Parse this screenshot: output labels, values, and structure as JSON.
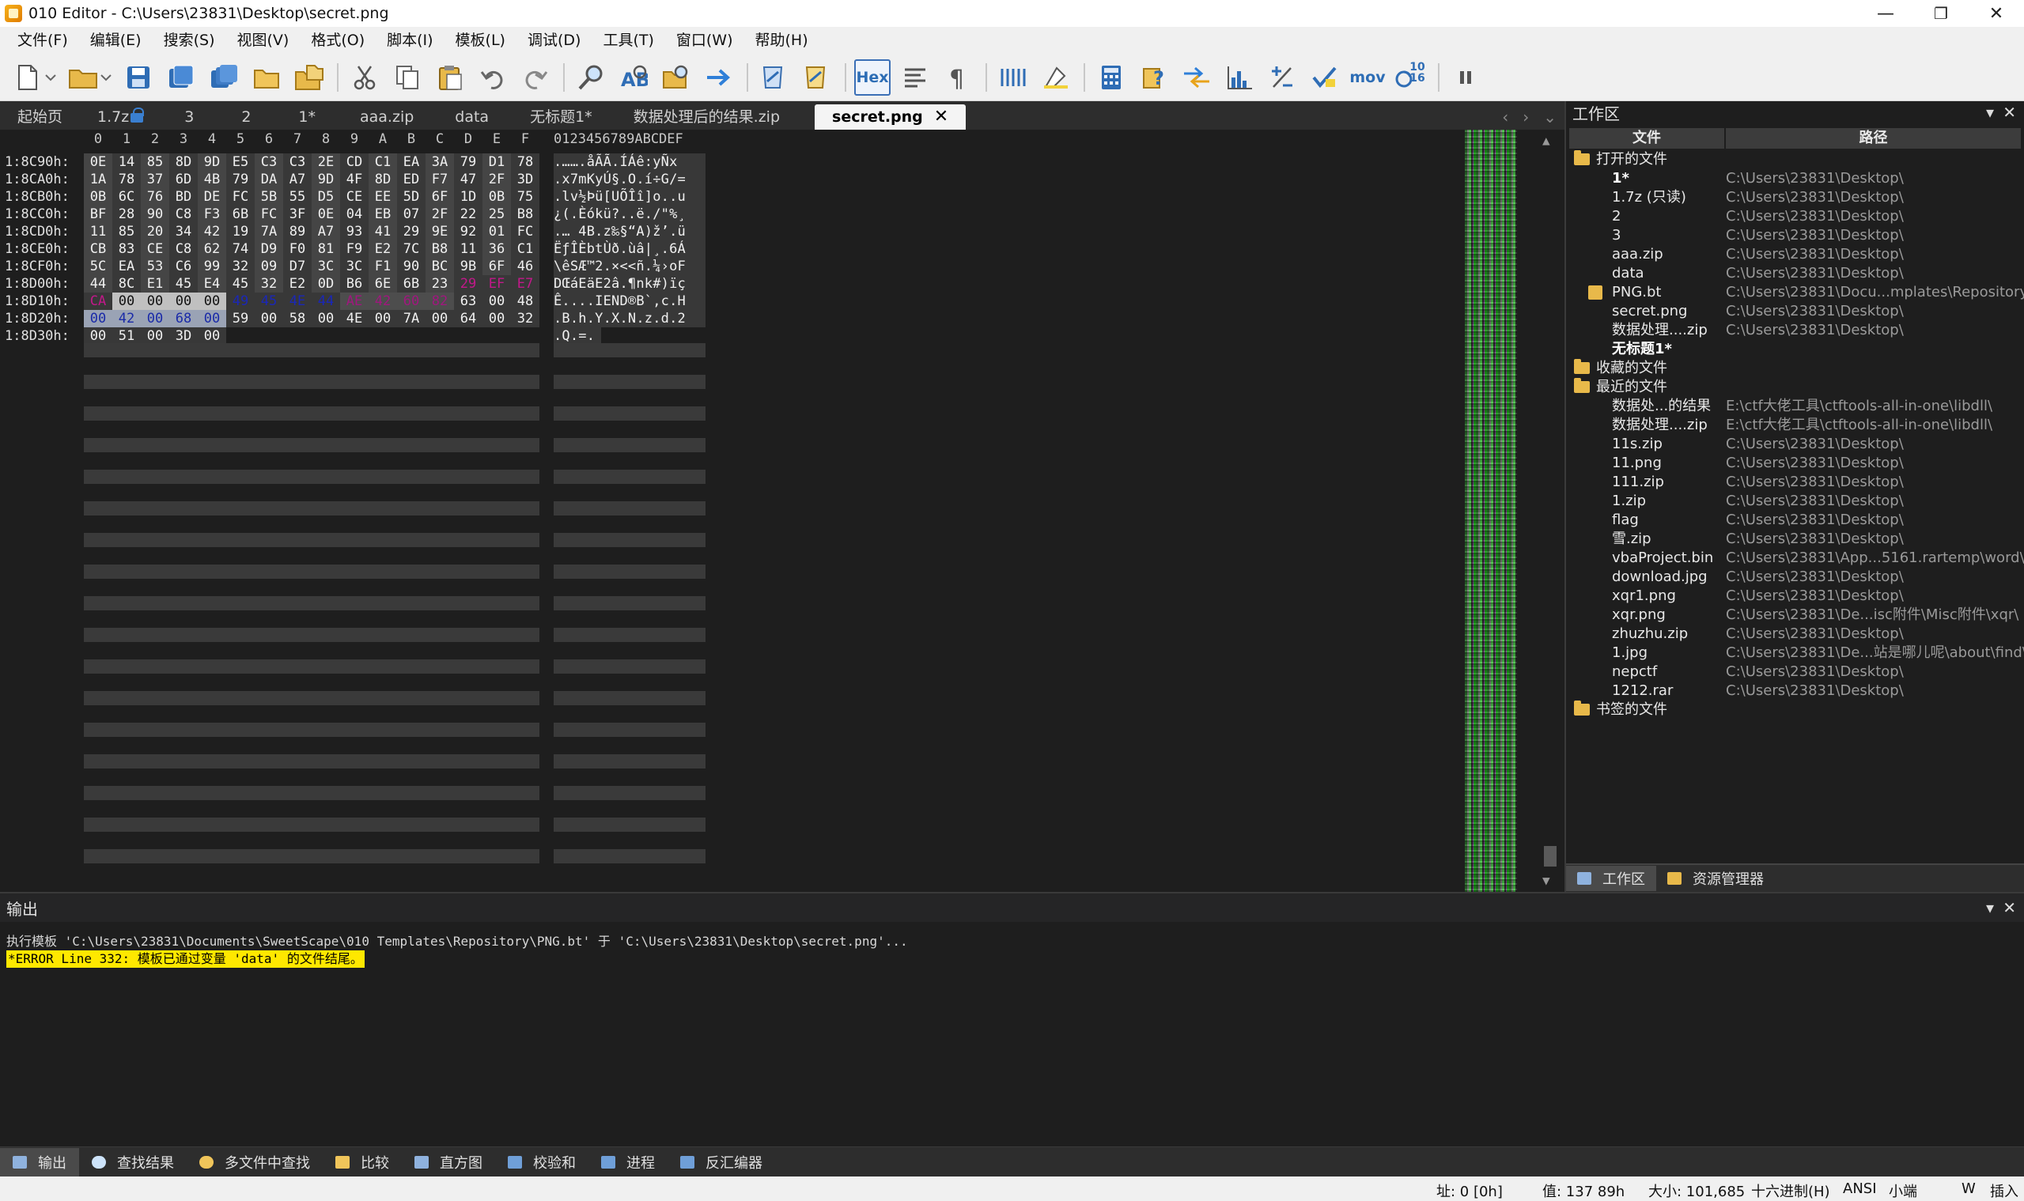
{
  "window": {
    "title": "010 Editor - C:\\Users\\23831\\Desktop\\secret.png",
    "minimize": "—",
    "restore": "❐",
    "close": "✕"
  },
  "menu": [
    "文件(F)",
    "编辑(E)",
    "搜索(S)",
    "视图(V)",
    "格式(O)",
    "脚本(I)",
    "模板(L)",
    "调试(D)",
    "工具(T)",
    "窗口(W)",
    "帮助(H)"
  ],
  "toolbar": {
    "hex_label": "Hex",
    "mov_label": "mov",
    "base_label_top": "10",
    "base_label_bottom": "16"
  },
  "tabs": [
    {
      "label": "起始页"
    },
    {
      "label": "1.7z",
      "locked": true
    },
    {
      "label": "3"
    },
    {
      "label": "2"
    },
    {
      "label": "1*"
    },
    {
      "label": "aaa.zip"
    },
    {
      "label": "data"
    },
    {
      "label": "无标题1*"
    },
    {
      "label": "数据处理后的结果.zip"
    },
    {
      "label": "secret.png",
      "active": true
    }
  ],
  "hex": {
    "header_cols": [
      "0",
      "1",
      "2",
      "3",
      "4",
      "5",
      "6",
      "7",
      "8",
      "9",
      "A",
      "B",
      "C",
      "D",
      "E",
      "F"
    ],
    "ascii_header": "0123456789ABCDEF",
    "rows": [
      {
        "addr": "1:8C90h:",
        "bytes": [
          "0E",
          "14",
          "85",
          "8D",
          "9D",
          "E5",
          "C3",
          "C3",
          "2E",
          "CD",
          "C1",
          "EA",
          "3A",
          "79",
          "D1",
          "78"
        ],
        "ascii": ".…….åÃÃ.ÍÁê:yÑx"
      },
      {
        "addr": "1:8CA0h:",
        "bytes": [
          "1A",
          "78",
          "37",
          "6D",
          "4B",
          "79",
          "DA",
          "A7",
          "9D",
          "4F",
          "8D",
          "ED",
          "F7",
          "47",
          "2F",
          "3D"
        ],
        "ascii": ".x7mKyÚ§.O.í÷G/="
      },
      {
        "addr": "1:8CB0h:",
        "bytes": [
          "0B",
          "6C",
          "76",
          "BD",
          "DE",
          "FC",
          "5B",
          "55",
          "D5",
          "CE",
          "EE",
          "5D",
          "6F",
          "1D",
          "0B",
          "75"
        ],
        "ascii": ".lv½Þü[UÕÎî]o..u"
      },
      {
        "addr": "1:8CC0h:",
        "bytes": [
          "BF",
          "28",
          "90",
          "C8",
          "F3",
          "6B",
          "FC",
          "3F",
          "0E",
          "04",
          "EB",
          "07",
          "2F",
          "22",
          "25",
          "B8"
        ],
        "ascii": "¿(.Èókü?..ë./\"%¸"
      },
      {
        "addr": "1:8CD0h:",
        "bytes": [
          "11",
          "85",
          "20",
          "34",
          "42",
          "19",
          "7A",
          "89",
          "A7",
          "93",
          "41",
          "29",
          "9E",
          "92",
          "01",
          "FC"
        ],
        "ascii": ".… 4B.z‰§“A)ž’.ü"
      },
      {
        "addr": "1:8CE0h:",
        "bytes": [
          "CB",
          "83",
          "CE",
          "C8",
          "62",
          "74",
          "D9",
          "F0",
          "81",
          "F9",
          "E2",
          "7C",
          "B8",
          "11",
          "36",
          "C1"
        ],
        "ascii": "ËƒÎÈbtÙð.ùâ|¸.6Á"
      },
      {
        "addr": "1:8CF0h:",
        "bytes": [
          "5C",
          "EA",
          "53",
          "C6",
          "99",
          "32",
          "09",
          "D7",
          "3C",
          "3C",
          "F1",
          "90",
          "BC",
          "9B",
          "6F",
          "46"
        ],
        "ascii": "\\êSÆ™2.×<<ñ.¼›oF"
      },
      {
        "addr": "1:8D00h:",
        "bytes": [
          "44",
          "8C",
          "E1",
          "45",
          "E4",
          "45",
          "32",
          "E2",
          "0D",
          "B6",
          "6E",
          "6B",
          "23",
          "29",
          "EF",
          "E7"
        ],
        "ascii": "DŒáEäE2â.¶nk#)ïç"
      },
      {
        "addr": "1:8D10h:",
        "bytes": [
          "CA",
          "00",
          "00",
          "00",
          "00",
          "49",
          "45",
          "4E",
          "44",
          "AE",
          "42",
          "60",
          "82",
          "63",
          "00",
          "48"
        ],
        "ascii": "Ê....IEND®B`‚c.H"
      },
      {
        "addr": "1:8D20h:",
        "bytes": [
          "00",
          "42",
          "00",
          "68",
          "00",
          "59",
          "00",
          "58",
          "00",
          "4E",
          "00",
          "7A",
          "00",
          "64",
          "00",
          "32"
        ],
        "ascii": ".B.h.Y.X.N.z.d.2"
      },
      {
        "addr": "1:8D30h:",
        "bytes": [
          "00",
          "51",
          "00",
          "3D",
          "00"
        ],
        "ascii": ".Q.=."
      }
    ]
  },
  "workspace": {
    "title": "工作区",
    "col_file": "文件",
    "col_path": "路径",
    "groups": [
      {
        "label": "打开的文件",
        "items": [
          {
            "name": "1*",
            "path": "C:\\Users\\23831\\Desktop\\",
            "bold": true
          },
          {
            "name": "1.7z (只读)",
            "path": "C:\\Users\\23831\\Desktop\\"
          },
          {
            "name": "2",
            "path": "C:\\Users\\23831\\Desktop\\"
          },
          {
            "name": "3",
            "path": "C:\\Users\\23831\\Desktop\\"
          },
          {
            "name": "aaa.zip",
            "path": "C:\\Users\\23831\\Desktop\\"
          },
          {
            "name": "data",
            "path": "C:\\Users\\23831\\Desktop\\"
          },
          {
            "name": "PNG.bt",
            "path": "C:\\Users\\23831\\Docu...mplates\\Repository\\",
            "icon": true
          },
          {
            "name": "secret.png",
            "path": "C:\\Users\\23831\\Desktop\\"
          },
          {
            "name": "数据处理....zip",
            "path": "C:\\Users\\23831\\Desktop\\"
          },
          {
            "name": "无标题1*",
            "path": "",
            "bold": true
          }
        ]
      },
      {
        "label": "收藏的文件",
        "items": []
      },
      {
        "label": "最近的文件",
        "items": [
          {
            "name": "数据处...的结果",
            "path": "E:\\ctf大佬工具\\ctftools-all-in-one\\libdll\\"
          },
          {
            "name": "数据处理....zip",
            "path": "E:\\ctf大佬工具\\ctftools-all-in-one\\libdll\\"
          },
          {
            "name": "11s.zip",
            "path": "C:\\Users\\23831\\Desktop\\"
          },
          {
            "name": "11.png",
            "path": "C:\\Users\\23831\\Desktop\\"
          },
          {
            "name": "111.zip",
            "path": "C:\\Users\\23831\\Desktop\\"
          },
          {
            "name": "1.zip",
            "path": "C:\\Users\\23831\\Desktop\\"
          },
          {
            "name": "flag",
            "path": "C:\\Users\\23831\\Desktop\\"
          },
          {
            "name": "雪.zip",
            "path": "C:\\Users\\23831\\Desktop\\"
          },
          {
            "name": "vbaProject.bin",
            "path": "C:\\Users\\23831\\App...5161.rartemp\\word\\"
          },
          {
            "name": "download.jpg",
            "path": "C:\\Users\\23831\\Desktop\\"
          },
          {
            "name": "xqr1.png",
            "path": "C:\\Users\\23831\\Desktop\\"
          },
          {
            "name": "xqr.png",
            "path": "C:\\Users\\23831\\De...isc附件\\Misc附件\\xqr\\"
          },
          {
            "name": "zhuzhu.zip",
            "path": "C:\\Users\\23831\\Desktop\\"
          },
          {
            "name": "1.jpg",
            "path": "C:\\Users\\23831\\De...站是哪儿呢\\about\\find\\"
          },
          {
            "name": "nepctf",
            "path": "C:\\Users\\23831\\Desktop\\"
          },
          {
            "name": "1212.rar",
            "path": "C:\\Users\\23831\\Desktop\\"
          }
        ]
      },
      {
        "label": "书签的文件",
        "items": []
      }
    ],
    "bottom_tabs": [
      "工作区",
      "资源管理器"
    ]
  },
  "output": {
    "title": "输出",
    "line1": "执行模板 'C:\\Users\\23831\\Documents\\SweetScape\\010 Templates\\Repository\\PNG.bt' 于 'C:\\Users\\23831\\Desktop\\secret.png'...",
    "error": "*ERROR Line 332: 模板已通过变量 'data' 的文件结尾。"
  },
  "bottom_tabs": [
    "输出",
    "查找结果",
    "多文件中查找",
    "比较",
    "直方图",
    "校验和",
    "进程",
    "反汇编器"
  ],
  "status": {
    "address": "址: 0 [0h]",
    "value": "值: 137 89h",
    "size": "大小: 101,685",
    "mode": "十六进制(H)",
    "encoding": "ANSI",
    "endian": "小端",
    "write": "W",
    "insert": "插入"
  },
  "colors": {
    "accent": "#3b6fb6",
    "error_bg": "#ffe800",
    "template_pink": "#c2188a",
    "template_blue": "#1a27b8"
  }
}
